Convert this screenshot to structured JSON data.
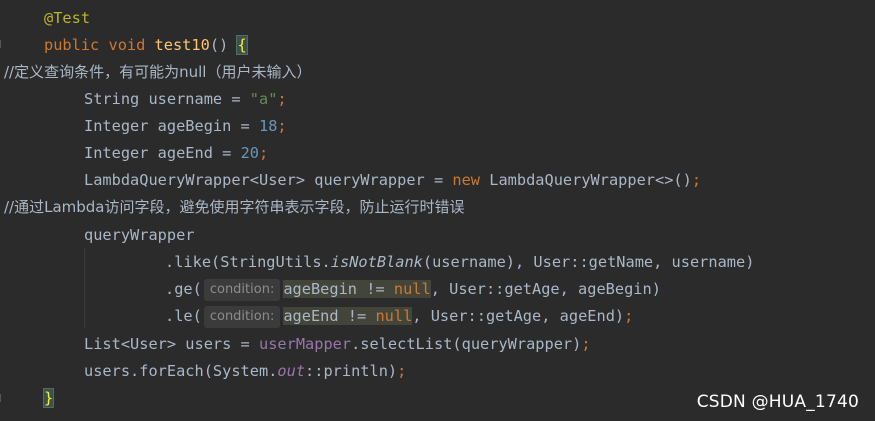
{
  "code": {
    "annotation": "@Test",
    "kw_public": "public",
    "kw_void": "void",
    "method_name": "test10",
    "open_paren": "() ",
    "open_brace": "{",
    "comment1": "//定义查询条件，有可能为null（用户未输入）",
    "line_username_decl": "String username = ",
    "username_value": "\"a\"",
    "semicolon": ";",
    "line_agebegin_decl": "Integer ageBegin = ",
    "agebegin_value": "18",
    "line_ageend_decl": "Integer ageEnd = ",
    "ageend_value": "20",
    "line_wrapper_decl": "LambdaQueryWrapper<User> queryWrapper = ",
    "kw_new": "new",
    "wrapper_ctor": " LambdaQueryWrapper<>()",
    "comment2": "//通过Lambda访问字段，避免使用字符串表示字段，防止运行时错误",
    "query_wrapper": "queryWrapper",
    "like_prefix": ".like(StringUtils.",
    "is_not_blank": "isNotBlank",
    "like_args": "(username), User::getName, username)",
    "ge_prefix": ".ge(",
    "condition_hint": "condition:",
    "ge_condition_expr": "ageBegin != ",
    "kw_null": "null",
    "ge_rest": ", User::getAge, ageBegin)",
    "le_prefix": ".le(",
    "le_condition_expr": "ageEnd != ",
    "le_rest": ", User::getAge, ageEnd)",
    "list_decl": "List<User> users = ",
    "user_mapper": "userMapper",
    "select_list": ".selectList(queryWrapper)",
    "foreach_prefix": "users.forEach(System.",
    "out_field": "out",
    "foreach_suffix": "::println)",
    "close_brace": "}"
  },
  "watermark": "CSDN @HUA_1740",
  "colors": {
    "background": "#2b2b2b",
    "keyword": "#cc7832",
    "string": "#6a8759",
    "number": "#6897bb",
    "field": "#9876aa",
    "method_declaration": "#ffc66d",
    "annotation": "#bbb529"
  }
}
